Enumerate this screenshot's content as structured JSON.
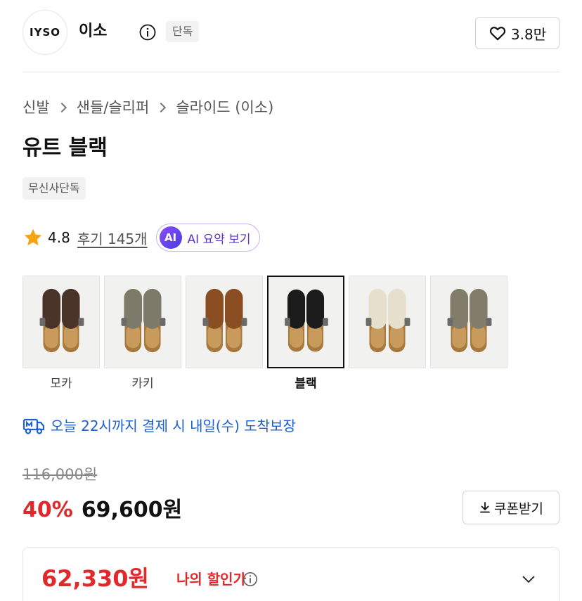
{
  "brand": {
    "logo_text": "IYSO",
    "name": "이소",
    "badge": "단독",
    "like_count": "3.8만"
  },
  "breadcrumb": [
    "신발",
    "샌들/슬리퍼",
    "슬라이드 (이소)"
  ],
  "product": {
    "title": "유트 블랙",
    "exclusive_badge": "무신사단독"
  },
  "rating": {
    "score": "4.8",
    "review_link": "후기 145개",
    "ai_badge": "AI",
    "ai_button_label": "AI 요약 보기"
  },
  "colors": {
    "selected_index": 3,
    "items": [
      {
        "label": "모카",
        "color": "#4a3328"
      },
      {
        "label": "카키",
        "color": "#7d7a69"
      },
      {
        "label": "",
        "color": "#8a4e22"
      },
      {
        "label": "블랙",
        "color": "#1b1b1b"
      },
      {
        "label": "",
        "color": "#e6dfcc"
      },
      {
        "label": "",
        "color": "#827d6b"
      }
    ]
  },
  "delivery": {
    "text": "오늘 22시까지 결제 시 내일(수) 도착보장",
    "accent": "#1a5fd6"
  },
  "price": {
    "original": "116,000원",
    "discount_rate": "40%",
    "sale": "69,600원",
    "coupon_label": "쿠폰받기",
    "accent": "#e0292a"
  },
  "my_price": {
    "value": "62,330원",
    "label": "나의 할인가"
  }
}
